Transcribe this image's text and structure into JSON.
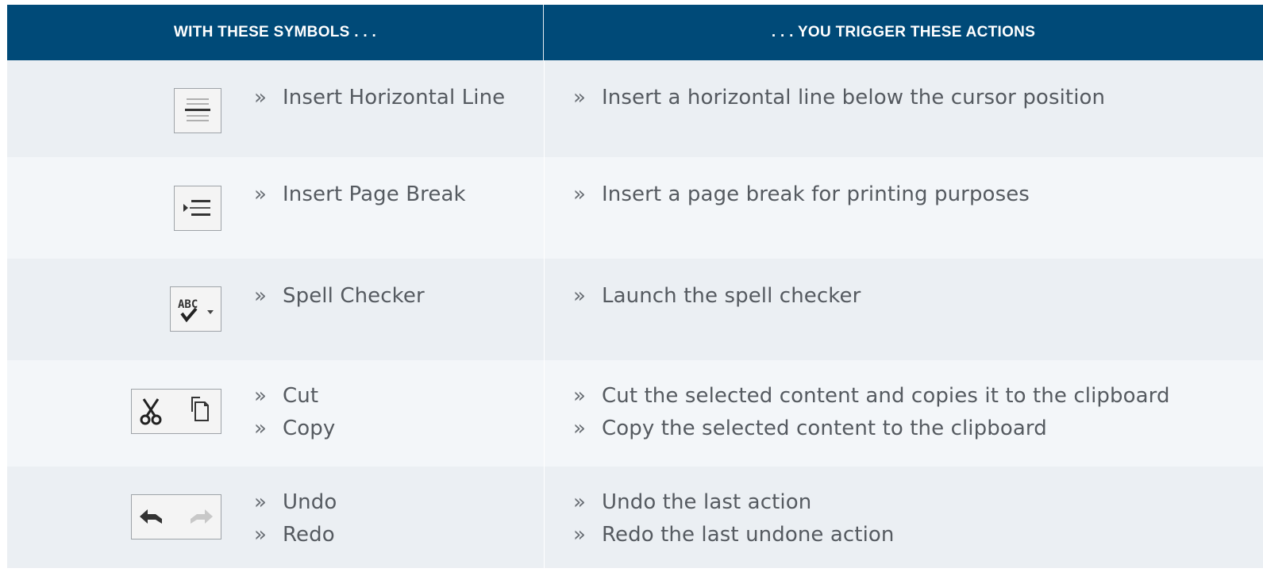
{
  "header": {
    "left": "WITH THESE SYMBOLS . . .",
    "right": ". . . YOU TRIGGER THESE ACTIONS"
  },
  "rows": [
    {
      "icons": [
        "horizontal-line-icon"
      ],
      "symbols": [
        "Insert Horizontal Line"
      ],
      "actions": [
        "Insert a horizontal line below the cursor position"
      ]
    },
    {
      "icons": [
        "page-break-icon"
      ],
      "symbols": [
        "Insert Page Break"
      ],
      "actions": [
        "Insert a page break for printing purposes"
      ]
    },
    {
      "icons": [
        "spell-check-icon"
      ],
      "symbols": [
        "Spell Checker"
      ],
      "actions": [
        "Launch the spell checker"
      ]
    },
    {
      "icons": [
        "scissors-icon",
        "copy-icon"
      ],
      "symbols": [
        "Cut",
        "Copy"
      ],
      "actions": [
        "Cut the selected content and copies it to the clipboard",
        "Copy the selected content to the clipboard"
      ]
    },
    {
      "icons": [
        "undo-icon",
        "redo-icon"
      ],
      "symbols": [
        "Undo",
        "Redo"
      ],
      "actions": [
        "Undo the last action",
        "Redo the last undone action"
      ]
    }
  ],
  "bullet": "»",
  "colors": {
    "header_bg": "#004a78",
    "header_text": "#ffffff",
    "row_odd": "#ebeff3",
    "row_even": "#f3f6f9",
    "body_text": "#555a60"
  }
}
